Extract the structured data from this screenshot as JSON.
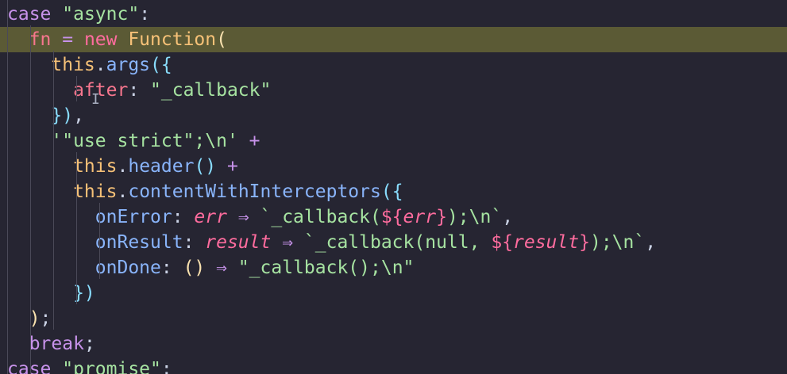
{
  "editor": {
    "lines": [
      {
        "tokens": [
          {
            "t": "case ",
            "c": "kw"
          },
          {
            "t": "\"async\"",
            "c": "str"
          },
          {
            "t": ":",
            "c": "punct"
          }
        ]
      },
      {
        "tokens": [
          {
            "t": "  fn",
            "c": "id"
          },
          {
            "t": " = ",
            "c": "op"
          },
          {
            "t": "new ",
            "c": "kw2"
          },
          {
            "t": "Function",
            "c": "cls"
          },
          {
            "t": "(",
            "c": "paren"
          }
        ]
      },
      {
        "tokens": [
          {
            "t": "    this",
            "c": "cls"
          },
          {
            "t": ".",
            "c": "punct"
          },
          {
            "t": "args",
            "c": "fn"
          },
          {
            "t": "({",
            "c": "brace"
          }
        ]
      },
      {
        "tokens": [
          {
            "t": "      after",
            "c": "id"
          },
          {
            "t": ": ",
            "c": "punct"
          },
          {
            "t": "\"_callback\"",
            "c": "str"
          }
        ]
      },
      {
        "tokens": [
          {
            "t": "    })",
            "c": "brace"
          },
          {
            "t": ",",
            "c": "punct"
          }
        ]
      },
      {
        "tokens": [
          {
            "t": "    '\"use strict\";\\n'",
            "c": "str"
          },
          {
            "t": " +",
            "c": "op"
          }
        ]
      },
      {
        "tokens": [
          {
            "t": "      this",
            "c": "cls"
          },
          {
            "t": ".",
            "c": "punct"
          },
          {
            "t": "header",
            "c": "fn"
          },
          {
            "t": "()",
            "c": "brace"
          },
          {
            "t": " +",
            "c": "op"
          }
        ]
      },
      {
        "tokens": [
          {
            "t": "      this",
            "c": "cls"
          },
          {
            "t": ".",
            "c": "punct"
          },
          {
            "t": "contentWithInterceptors",
            "c": "fn"
          },
          {
            "t": "({",
            "c": "brace"
          }
        ]
      },
      {
        "tokens": [
          {
            "t": "        onError",
            "c": "fn"
          },
          {
            "t": ": ",
            "c": "punct"
          },
          {
            "t": "err",
            "c": "italic"
          },
          {
            "t": " ⇒ ",
            "c": "op"
          },
          {
            "t": "`_callback(",
            "c": "tpl"
          },
          {
            "t": "${",
            "c": "kw2"
          },
          {
            "t": "err",
            "c": "italic"
          },
          {
            "t": "}",
            "c": "kw2"
          },
          {
            "t": ");\\n`",
            "c": "tpl"
          },
          {
            "t": ",",
            "c": "punct"
          }
        ]
      },
      {
        "tokens": [
          {
            "t": "        onResult",
            "c": "fn"
          },
          {
            "t": ": ",
            "c": "punct"
          },
          {
            "t": "result",
            "c": "italic"
          },
          {
            "t": " ⇒ ",
            "c": "op"
          },
          {
            "t": "`_callback(null, ",
            "c": "tpl"
          },
          {
            "t": "${",
            "c": "kw2"
          },
          {
            "t": "result",
            "c": "italic"
          },
          {
            "t": "}",
            "c": "kw2"
          },
          {
            "t": ");\\n`",
            "c": "tpl"
          },
          {
            "t": ",",
            "c": "punct"
          }
        ]
      },
      {
        "tokens": [
          {
            "t": "        onDone",
            "c": "fn"
          },
          {
            "t": ": ",
            "c": "punct"
          },
          {
            "t": "()",
            "c": "paren"
          },
          {
            "t": " ⇒ ",
            "c": "op"
          },
          {
            "t": "\"_callback();\\n\"",
            "c": "str"
          }
        ]
      },
      {
        "tokens": [
          {
            "t": "      })",
            "c": "brace"
          }
        ]
      },
      {
        "tokens": [
          {
            "t": "  )",
            "c": "paren"
          },
          {
            "t": ";",
            "c": "punct"
          }
        ]
      },
      {
        "tokens": [
          {
            "t": "  break",
            "c": "kw"
          },
          {
            "t": ";",
            "c": "punct"
          }
        ]
      },
      {
        "tokens": [
          {
            "t": "case ",
            "c": "kw"
          },
          {
            "t": "\"promise\"",
            "c": "str"
          },
          {
            "t": ":",
            "c": "punct"
          }
        ]
      }
    ],
    "highlighted_line": 1,
    "cursor_glyph": "I"
  }
}
